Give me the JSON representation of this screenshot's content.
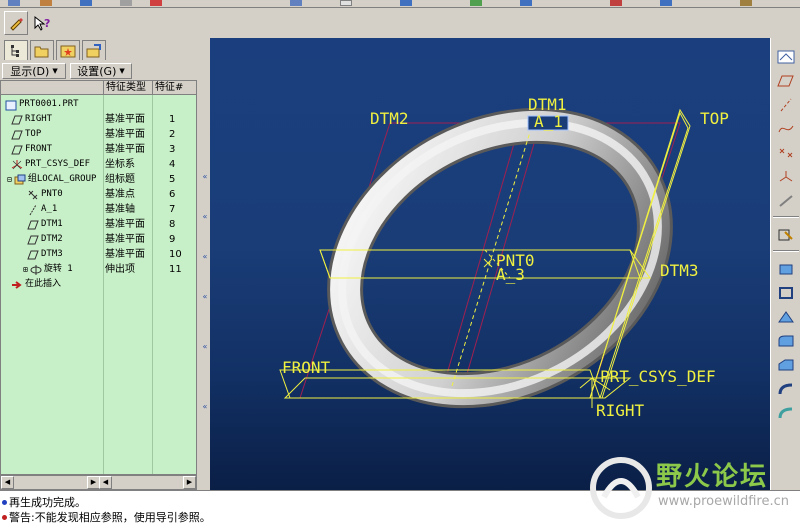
{
  "panel": {
    "display_menu": "显示(D)",
    "settings_menu": "设置(G)",
    "columns": [
      "",
      "特征类型",
      "特征#"
    ]
  },
  "tree": {
    "root": "PRT0001.PRT",
    "items": [
      {
        "name": "RIGHT",
        "type": "基准平面",
        "num": "1",
        "icon": "datum-plane-icon"
      },
      {
        "name": "TOP",
        "type": "基准平面",
        "num": "2",
        "icon": "datum-plane-icon"
      },
      {
        "name": "FRONT",
        "type": "基准平面",
        "num": "3",
        "icon": "datum-plane-icon"
      },
      {
        "name": "PRT_CSYS_DEF",
        "type": "坐标系",
        "num": "4",
        "icon": "csys-icon"
      },
      {
        "name": "组LOCAL_GROUP",
        "type": "组标题",
        "num": "5",
        "icon": "group-icon"
      },
      {
        "name": "PNT0",
        "type": "基准点",
        "num": "6",
        "icon": "datum-point-icon"
      },
      {
        "name": "A_1",
        "type": "基准轴",
        "num": "7",
        "icon": "datum-axis-icon"
      },
      {
        "name": "DTM1",
        "type": "基准平面",
        "num": "8",
        "icon": "datum-plane-icon"
      },
      {
        "name": "DTM2",
        "type": "基准平面",
        "num": "9",
        "icon": "datum-plane-icon"
      },
      {
        "name": "DTM3",
        "type": "基准平面",
        "num": "10",
        "icon": "datum-plane-icon"
      },
      {
        "name": "旋转 1",
        "type": "伸出项",
        "num": "11",
        "icon": "revolve-icon"
      }
    ],
    "insert_here": "在此插入"
  },
  "graphics": {
    "labels": {
      "dtm1": "DTM1",
      "dtm2": "DTM2",
      "dtm3": "DTM3",
      "top": "TOP",
      "front": "FRONT",
      "right": "RIGHT",
      "csys": "PRT_CSYS_DEF",
      "pnt0": "PNT0",
      "a1": "A_1",
      "a3": "A_3"
    }
  },
  "status": {
    "message1": "再生成功完成。",
    "message2": "警告:不能发现相应参照，使用导引参照。"
  },
  "watermark": {
    "title": "野火论坛",
    "url": "www.proewildfire.cn"
  },
  "colors": {
    "tree_bg": "#c8f0c8",
    "datum": "#f0f040",
    "plane_edge": "#a02050"
  }
}
